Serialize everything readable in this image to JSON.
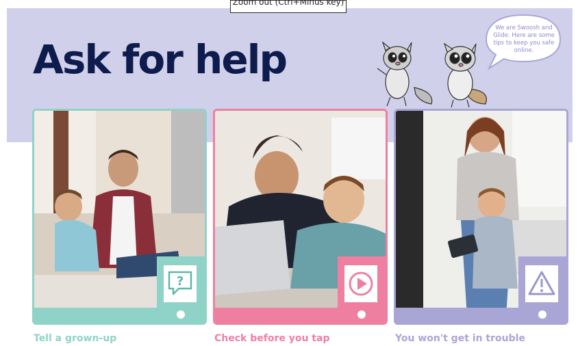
{
  "tooltip": {
    "text": "Zoom out (Ctrl+Minus key)"
  },
  "header": {
    "title": "Ask for help"
  },
  "speech_bubble": {
    "text": "We are Swoosh and Glide. Here are some tips to keep you safe online."
  },
  "colors": {
    "banner": "#d0d0eb",
    "title": "#0e1b4d",
    "teal": "#8fd3c8",
    "pink": "#ef7fa0",
    "lavender": "#a9a6d6"
  },
  "cards": [
    {
      "caption": "Tell a grown-up",
      "icon": "question-speech-icon"
    },
    {
      "caption": "Check before you tap",
      "icon": "play-icon"
    },
    {
      "caption": "You won't get in trouble",
      "icon": "warning-icon"
    }
  ]
}
